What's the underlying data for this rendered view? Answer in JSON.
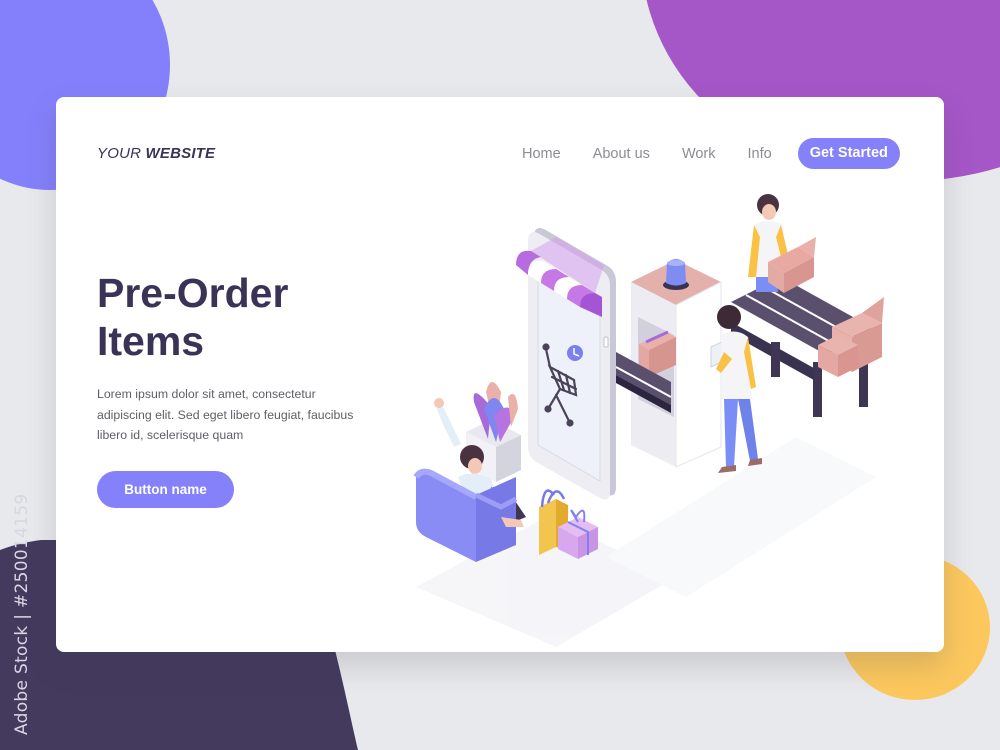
{
  "header": {
    "logo_light": "YOUR",
    "logo_bold": "WEBSITE",
    "nav": [
      {
        "label": "Home"
      },
      {
        "label": "About us"
      },
      {
        "label": "Work"
      },
      {
        "label": "Info"
      }
    ],
    "cta_label": "Get Started"
  },
  "hero": {
    "title": "Pre-Order Items",
    "description": "Lorem ipsum dolor sit amet, consectetur adipiscing elit. Sed eget libero feugiat, faucibus libero id, scelerisque quam",
    "button_label": "Button name"
  },
  "watermark": "Adobe Stock | #250014159",
  "colors": {
    "accent": "#8481fb",
    "heading": "#3b3356",
    "nav_text": "#8c8c94",
    "background": "#e8e9ec",
    "blob_blue": "#8480fb",
    "blob_purple": "#a557c7",
    "blob_yellow": "#fcc85e",
    "blob_dark": "#433a5e"
  },
  "illustration": {
    "description": "Isometric scene: shopping app phone with awning and cart, conveyor belt with boxes, workers, customer in armchair, shopping bag and gift",
    "icons": [
      "storefront-awning-icon",
      "shopping-cart-icon",
      "clock-icon",
      "conveyor-belt-icon",
      "box-icon",
      "gift-icon",
      "shopping-bag-icon",
      "armchair-icon",
      "plant-icon",
      "beacon-light-icon",
      "laptop-icon"
    ]
  }
}
